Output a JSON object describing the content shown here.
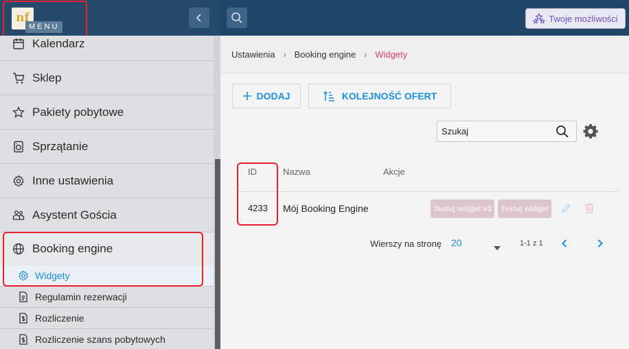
{
  "header": {
    "logo_text": "nf",
    "menu_label": "MENU",
    "collapse_icon": "chevron-left-icon",
    "search_icon": "search-icon",
    "twoje_label": "Twoje możliwości",
    "accent_color": "#1f4668"
  },
  "sidebar": {
    "items": [
      {
        "label": "Kalendarz",
        "icon": "calendar-icon"
      },
      {
        "label": "Sklep",
        "icon": "cart-icon"
      },
      {
        "label": "Pakiety pobytowe",
        "icon": "star-icon"
      },
      {
        "label": "Sprzątanie",
        "icon": "washer-icon"
      },
      {
        "label": "Inne ustawienia",
        "icon": "gear-icon"
      },
      {
        "label": "Asystent Gościa",
        "icon": "people-icon"
      },
      {
        "label": "Booking engine",
        "icon": "globe-icon"
      }
    ],
    "subitems": [
      {
        "label": "Widgety",
        "icon": "gear-icon",
        "active": true
      },
      {
        "label": "Regulamin rezerwacji",
        "icon": "document-icon"
      },
      {
        "label": "Rozliczenie",
        "icon": "dollar-document-icon"
      },
      {
        "label": "Rozliczenie szans pobytowych",
        "icon": "dollar-document-icon"
      }
    ]
  },
  "breadcrumb": [
    "Ustawienia",
    "Booking engine",
    "Widgety"
  ],
  "toolbar": {
    "add_label": "DODAJ",
    "order_label": "KOLEJNOŚĆ OFERT"
  },
  "search": {
    "placeholder": "Szukaj"
  },
  "table": {
    "columns": [
      "ID",
      "Nazwa",
      "Akcje"
    ],
    "rows": [
      {
        "id": "4233",
        "name": "Mój Booking Engine",
        "actions": [
          "Testuj widget v3",
          "Testuj widget"
        ]
      }
    ]
  },
  "pagination": {
    "rows_label": "Wierszy na stronę",
    "rows_value": "20",
    "range": "1-1 z 1"
  }
}
